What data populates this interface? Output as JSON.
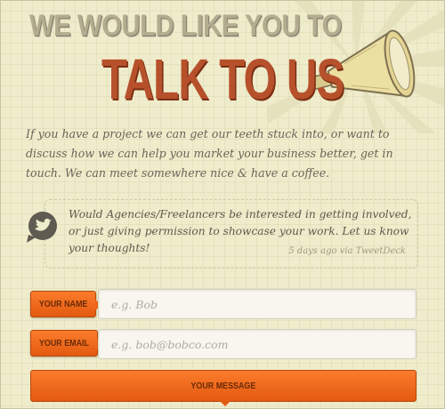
{
  "headline": {
    "line1": "WE WOULD LIKE YOU TO",
    "line2": "TALK TO US"
  },
  "intro": "If you have a project we can get our teeth stuck into, or want to discuss how we can help you market your business better, get in touch. We can meet somewhere nice & have a coffee.",
  "tweet": {
    "icon": "twitter-bird-icon",
    "text": "Would Agencies/Freelancers be interested in getting involved, or just giving permission to showcase your work. Let us know your thoughts!",
    "meta": "5 days ago via TweetDeck"
  },
  "form": {
    "name_label": "YOUR NAME",
    "name_placeholder": "e.g. Bob",
    "email_label": "YOUR EMAIL",
    "email_placeholder": "e.g. bob@bobco.com",
    "message_label": "YOUR MESSAGE"
  },
  "colors": {
    "accent": "#f06a1c",
    "headline_red": "#b6512c",
    "background": "#efeccb"
  }
}
